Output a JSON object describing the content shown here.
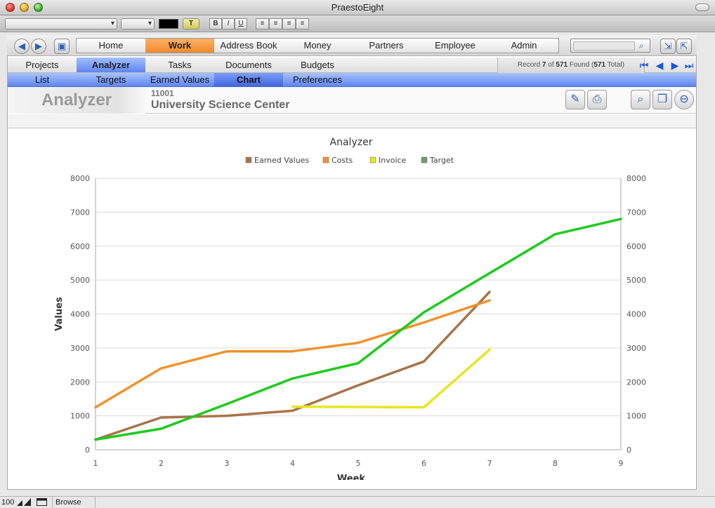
{
  "window": {
    "title": "PraestoEight"
  },
  "main_tabs": [
    "Home",
    "Work",
    "Address Book",
    "Money",
    "Partners",
    "Employee",
    "Admin"
  ],
  "active_main_tab": "Work",
  "sub_tabs": [
    "Projects",
    "Analyzer",
    "Tasks",
    "Documents",
    "Budgets"
  ],
  "active_sub_tab": "Analyzer",
  "record_info": {
    "prefix": "Record ",
    "current": "7",
    "of_label": " of ",
    "found_count": "571",
    "found_label": " Found (",
    "total": "571",
    "total_label": " Total)"
  },
  "view_tabs": [
    "List",
    "Targets",
    "Earned Values",
    "Chart",
    "Preferences"
  ],
  "active_view_tab": "Chart",
  "header": {
    "section_title": "Analyzer",
    "project_number": "11001",
    "project_name": "University Science Center"
  },
  "status_bar": {
    "zoom": "100",
    "mode": "Browse"
  },
  "colors": {
    "accent_orange": "#f08a2a",
    "accent_blue": "#5e86ef"
  },
  "icons": {
    "back": "arrow-left-icon",
    "forward": "arrow-right-icon",
    "tv": "tv-icon",
    "search": "magnifier-icon",
    "shrink": "collapse-icon",
    "expand": "expand-icon",
    "edit": "pencil-icon",
    "print": "printer-icon",
    "find": "find-icon",
    "duplicate": "duplicate-icon",
    "delete": "minus-icon"
  },
  "chart_data": {
    "type": "line",
    "title": "Analyzer",
    "xlabel": "Week",
    "ylabel": "Values",
    "x": [
      1,
      2,
      3,
      4,
      5,
      6,
      7,
      8,
      9
    ],
    "xlim": [
      1,
      9
    ],
    "ylim": [
      0,
      8000
    ],
    "yticks": [
      0,
      1000,
      2000,
      3000,
      4000,
      5000,
      6000,
      7000,
      8000
    ],
    "grid": true,
    "legend_position": "top",
    "series": [
      {
        "name": "Earned Values",
        "color": "#a9744a",
        "x": [
          1,
          2,
          3,
          4,
          5,
          6,
          7
        ],
        "values": [
          300,
          950,
          1000,
          1150,
          1900,
          2600,
          4650
        ]
      },
      {
        "name": "Costs",
        "color": "#f0922e",
        "x": [
          1,
          2,
          3,
          4,
          5,
          6,
          7
        ],
        "values": [
          1250,
          2400,
          2900,
          2900,
          3150,
          3750,
          4400
        ]
      },
      {
        "name": "Invoice",
        "color": "#e8e620",
        "x": [
          4,
          5,
          6,
          7
        ],
        "values": [
          1270,
          1260,
          1250,
          2950
        ]
      },
      {
        "name": "Target",
        "color": "#1dcb1d",
        "legend_color": "#6f9c6f",
        "x": [
          1,
          2,
          3,
          4,
          5,
          6,
          7,
          8,
          9
        ],
        "values": [
          300,
          620,
          1350,
          2100,
          2550,
          4050,
          5200,
          6350,
          6800
        ]
      }
    ]
  }
}
